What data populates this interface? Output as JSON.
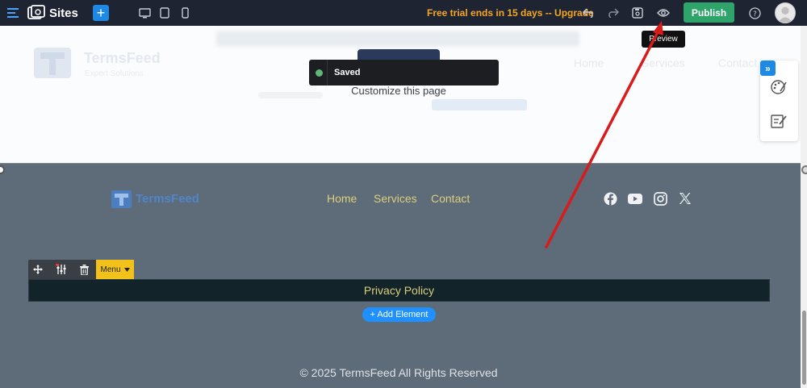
{
  "topbar": {
    "app_name": "Sites",
    "add_label": "+",
    "trial_text": "Free trial ends in 15 days -- Upgrade",
    "publish_label": "Publish"
  },
  "header": {
    "brand": "TermsFeed",
    "tagline": "Expert Solutions",
    "nav": [
      "Home",
      "Services",
      "Contact"
    ]
  },
  "toast": {
    "text": "Saved"
  },
  "customize_text": "Customize this page",
  "tooltip": "Preview",
  "footer": {
    "brand": "TermsFeed",
    "nav": [
      "Home",
      "Services",
      "Contact"
    ],
    "social_icons": [
      "facebook-icon",
      "youtube-icon",
      "instagram-icon",
      "x-icon"
    ],
    "menu_tag": "Menu",
    "privacy_label": "Privacy Policy",
    "add_element": "+ Add Element",
    "copyright": "© 2025 TermsFeed All Rights Reserved"
  },
  "colors": {
    "topbar_bg": "#1f2433",
    "accent_blue": "#1e88e5",
    "publish_green": "#2ea36a",
    "trial_orange": "#f5a623",
    "footer_bg": "#5e6b78",
    "nav_gold": "#d9cf7c",
    "menu_yellow": "#f2c21b",
    "annotation_red": "#d81b1b"
  }
}
